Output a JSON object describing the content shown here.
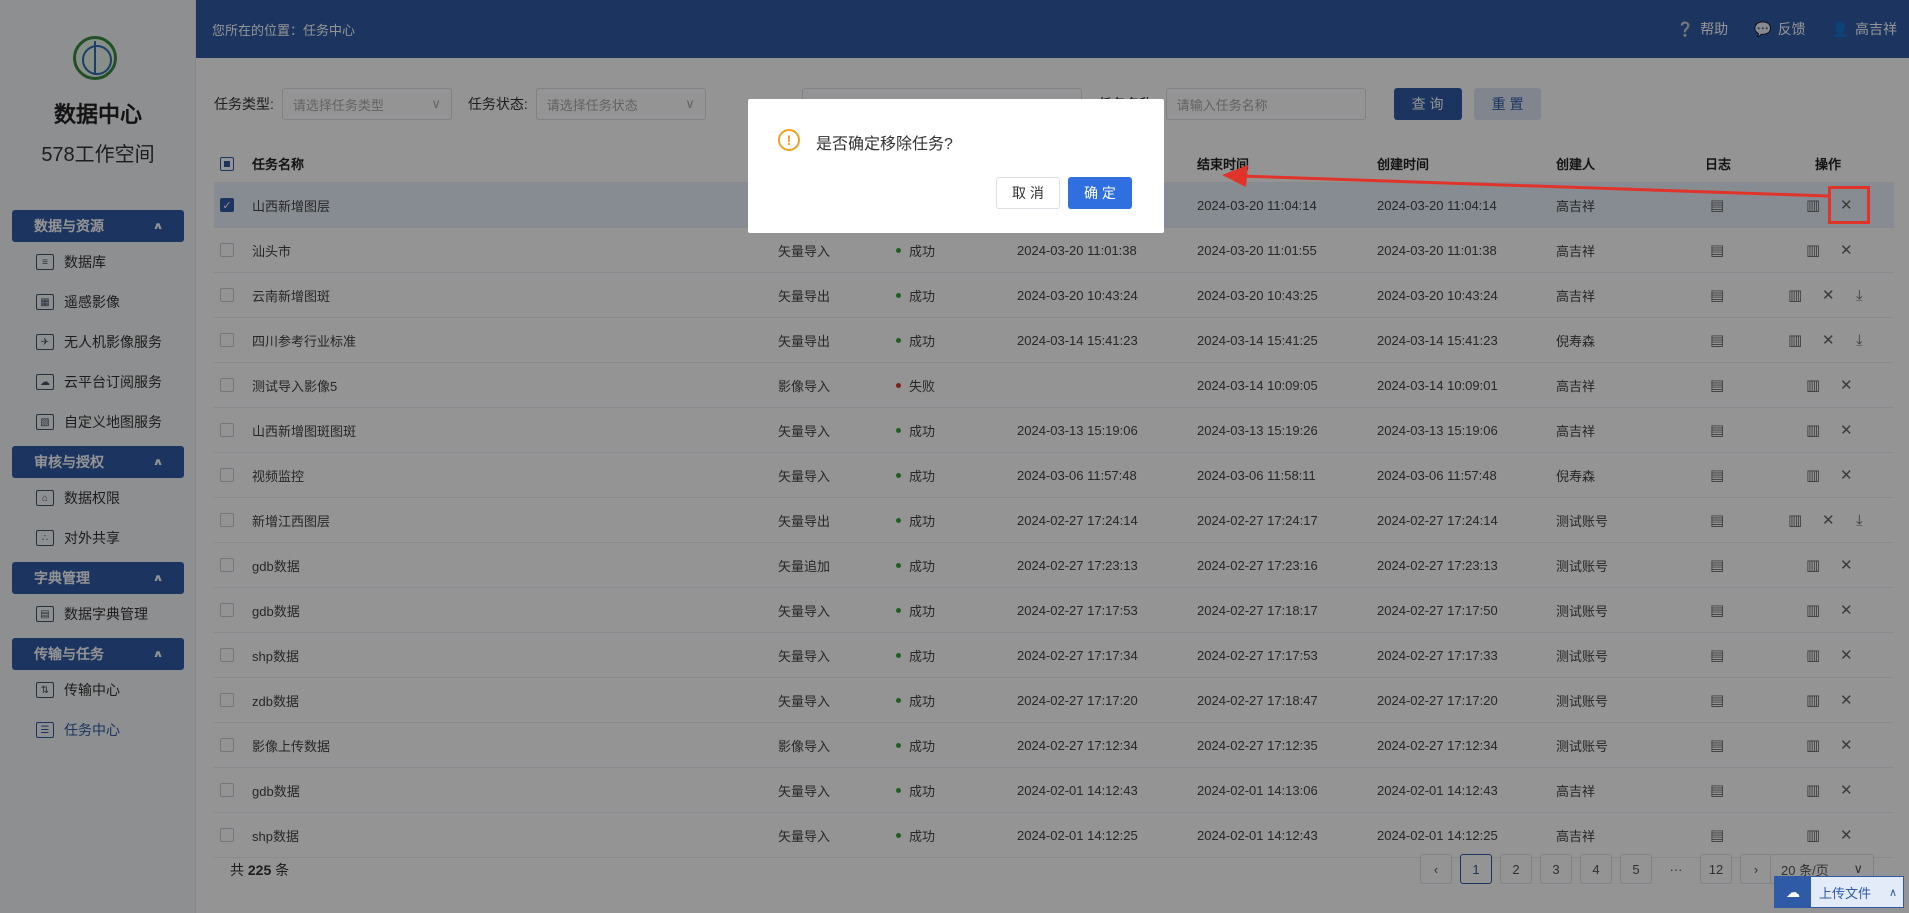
{
  "sidebar": {
    "brand": "数据中心",
    "workspace": "578工作空间",
    "groups": [
      {
        "label": "数据与资源",
        "items": [
          {
            "label": "数据库",
            "icon": "database-icon"
          },
          {
            "label": "遥感影像",
            "icon": "remote-sensing-icon"
          },
          {
            "label": "无人机影像服务",
            "icon": "drone-icon"
          },
          {
            "label": "云平台订阅服务",
            "icon": "cloud-icon"
          },
          {
            "label": "自定义地图服务",
            "icon": "map-icon"
          }
        ]
      },
      {
        "label": "审核与授权",
        "items": [
          {
            "label": "数据权限",
            "icon": "shield-icon"
          },
          {
            "label": "对外共享",
            "icon": "share-icon"
          }
        ]
      },
      {
        "label": "字典管理",
        "items": [
          {
            "label": "数据字典管理",
            "icon": "dictionary-icon"
          }
        ]
      },
      {
        "label": "传输与任务",
        "items": [
          {
            "label": "传输中心",
            "icon": "transfer-icon"
          },
          {
            "label": "任务中心",
            "icon": "task-icon",
            "active": true
          }
        ]
      }
    ]
  },
  "header": {
    "breadcrumb": "您所在的位置：任务中心",
    "help": "帮助",
    "feedback": "反馈",
    "user": "高吉祥"
  },
  "filter": {
    "task_type_label": "任务类型:",
    "task_type_placeholder": "请选择任务类型",
    "task_status_label": "任务状态:",
    "task_status_placeholder": "请选择任务状态",
    "task_name_label": "任务名称:",
    "task_name_placeholder": "请输入任务名称",
    "query": "查 询",
    "reset": "重 置"
  },
  "table": {
    "columns": [
      "任务名称",
      "结束时间",
      "创建时间",
      "创建人",
      "日志",
      "操作"
    ],
    "rows": [
      {
        "name": "山西新增图层",
        "type": "",
        "status": "",
        "ok": true,
        "start": "",
        "end": "2024-03-20 11:04:14",
        "created": "2024-03-20 11:04:14",
        "creator": "高吉祥",
        "download": false,
        "selected": true
      },
      {
        "name": "汕头市",
        "type": "矢量导入",
        "status": "成功",
        "ok": true,
        "start": "2024-03-20 11:01:38",
        "end": "2024-03-20 11:01:55",
        "created": "2024-03-20 11:01:38",
        "creator": "高吉祥",
        "download": false
      },
      {
        "name": "云南新增图斑",
        "type": "矢量导出",
        "status": "成功",
        "ok": true,
        "start": "2024-03-20 10:43:24",
        "end": "2024-03-20 10:43:25",
        "created": "2024-03-20 10:43:24",
        "creator": "高吉祥",
        "download": true
      },
      {
        "name": "四川参考行业标准",
        "type": "矢量导出",
        "status": "成功",
        "ok": true,
        "start": "2024-03-14 15:41:23",
        "end": "2024-03-14 15:41:25",
        "created": "2024-03-14 15:41:23",
        "creator": "倪寿森",
        "download": true
      },
      {
        "name": "测试导入影像5",
        "type": "影像导入",
        "status": "失败",
        "ok": false,
        "start": "",
        "end": "2024-03-14 10:09:05",
        "created": "2024-03-14 10:09:01",
        "creator": "高吉祥",
        "download": false
      },
      {
        "name": "山西新增图斑图斑",
        "type": "矢量导入",
        "status": "成功",
        "ok": true,
        "start": "2024-03-13 15:19:06",
        "end": "2024-03-13 15:19:26",
        "created": "2024-03-13 15:19:06",
        "creator": "高吉祥",
        "download": false
      },
      {
        "name": "视频监控",
        "type": "矢量导入",
        "status": "成功",
        "ok": true,
        "start": "2024-03-06 11:57:48",
        "end": "2024-03-06 11:58:11",
        "created": "2024-03-06 11:57:48",
        "creator": "倪寿森",
        "download": false
      },
      {
        "name": "新增江西图层",
        "type": "矢量导出",
        "status": "成功",
        "ok": true,
        "start": "2024-02-27 17:24:14",
        "end": "2024-02-27 17:24:17",
        "created": "2024-02-27 17:24:14",
        "creator": "测试账号",
        "download": true
      },
      {
        "name": "gdb数据",
        "type": "矢量追加",
        "status": "成功",
        "ok": true,
        "start": "2024-02-27 17:23:13",
        "end": "2024-02-27 17:23:16",
        "created": "2024-02-27 17:23:13",
        "creator": "测试账号",
        "download": false
      },
      {
        "name": "gdb数据",
        "type": "矢量导入",
        "status": "成功",
        "ok": true,
        "start": "2024-02-27 17:17:53",
        "end": "2024-02-27 17:18:17",
        "created": "2024-02-27 17:17:50",
        "creator": "测试账号",
        "download": false
      },
      {
        "name": "shp数据",
        "type": "矢量导入",
        "status": "成功",
        "ok": true,
        "start": "2024-02-27 17:17:34",
        "end": "2024-02-27 17:17:53",
        "created": "2024-02-27 17:17:33",
        "creator": "测试账号",
        "download": false
      },
      {
        "name": "zdb数据",
        "type": "矢量导入",
        "status": "成功",
        "ok": true,
        "start": "2024-02-27 17:17:20",
        "end": "2024-02-27 17:18:47",
        "created": "2024-02-27 17:17:20",
        "creator": "测试账号",
        "download": false
      },
      {
        "name": "影像上传数据",
        "type": "影像导入",
        "status": "成功",
        "ok": true,
        "start": "2024-02-27 17:12:34",
        "end": "2024-02-27 17:12:35",
        "created": "2024-02-27 17:12:34",
        "creator": "测试账号",
        "download": false
      },
      {
        "name": "gdb数据",
        "type": "矢量导入",
        "status": "成功",
        "ok": true,
        "start": "2024-02-01 14:12:43",
        "end": "2024-02-01 14:13:06",
        "created": "2024-02-01 14:12:43",
        "creator": "高吉祥",
        "download": false
      },
      {
        "name": "shp数据",
        "type": "矢量导入",
        "status": "成功",
        "ok": true,
        "start": "2024-02-01 14:12:25",
        "end": "2024-02-01 14:12:43",
        "created": "2024-02-01 14:12:25",
        "creator": "高吉祥",
        "download": false
      }
    ]
  },
  "footer": {
    "total_prefix": "共",
    "total": "225",
    "total_suffix": "条",
    "pages": [
      "1",
      "2",
      "3",
      "4",
      "5",
      "···",
      "12"
    ],
    "current_page": "1",
    "page_size": "20 条/页",
    "upload": "上传文件"
  },
  "dialog": {
    "message": "是否确定移除任务?",
    "cancel": "取 消",
    "confirm": "确 定"
  },
  "colors": {
    "primary": "#2f5aa5",
    "annotation": "#e0332a",
    "success": "#3aa23a",
    "fail": "#d9342b",
    "warning": "#f0a024"
  }
}
